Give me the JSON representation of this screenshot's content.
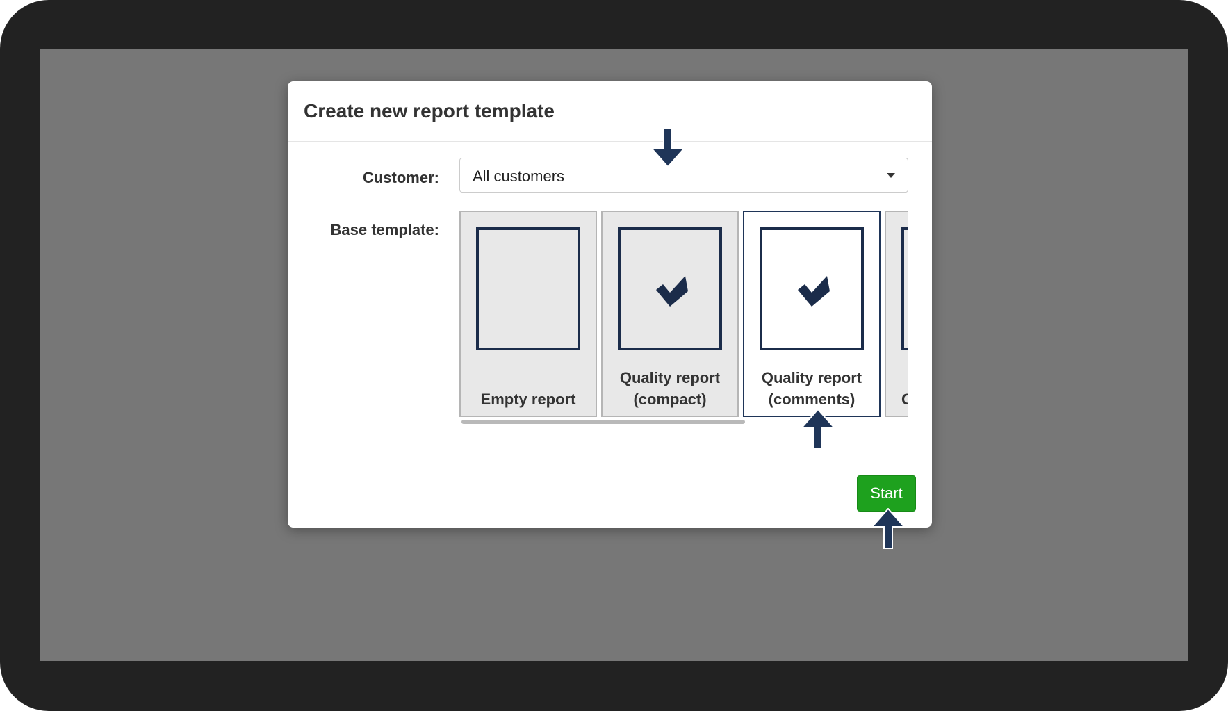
{
  "dialog": {
    "title": "Create new report template",
    "customer_label": "Customer:",
    "customer_value": "All customers",
    "base_template_label": "Base template:",
    "templates": [
      {
        "line1": "",
        "line2": "Empty report",
        "icon": "blank-page-icon",
        "selected": false
      },
      {
        "line1": "Quality report",
        "line2": "(compact)",
        "icon": "checkmark-icon",
        "selected": false
      },
      {
        "line1": "Quality report",
        "line2": "(comments)",
        "icon": "checkmark-icon",
        "selected": true
      },
      {
        "line1": "",
        "line2": "C",
        "icon": "page-icon",
        "selected": false
      }
    ],
    "start_label": "Start"
  },
  "annotations": {
    "arrow_color": "#1f3558",
    "arrows": [
      "down-arrow-icon",
      "up-arrow-icon",
      "up-arrow-icon"
    ]
  },
  "colors": {
    "accent_green": "#1ea11e",
    "selection_border": "#1f3558",
    "overlay": "#777777"
  }
}
